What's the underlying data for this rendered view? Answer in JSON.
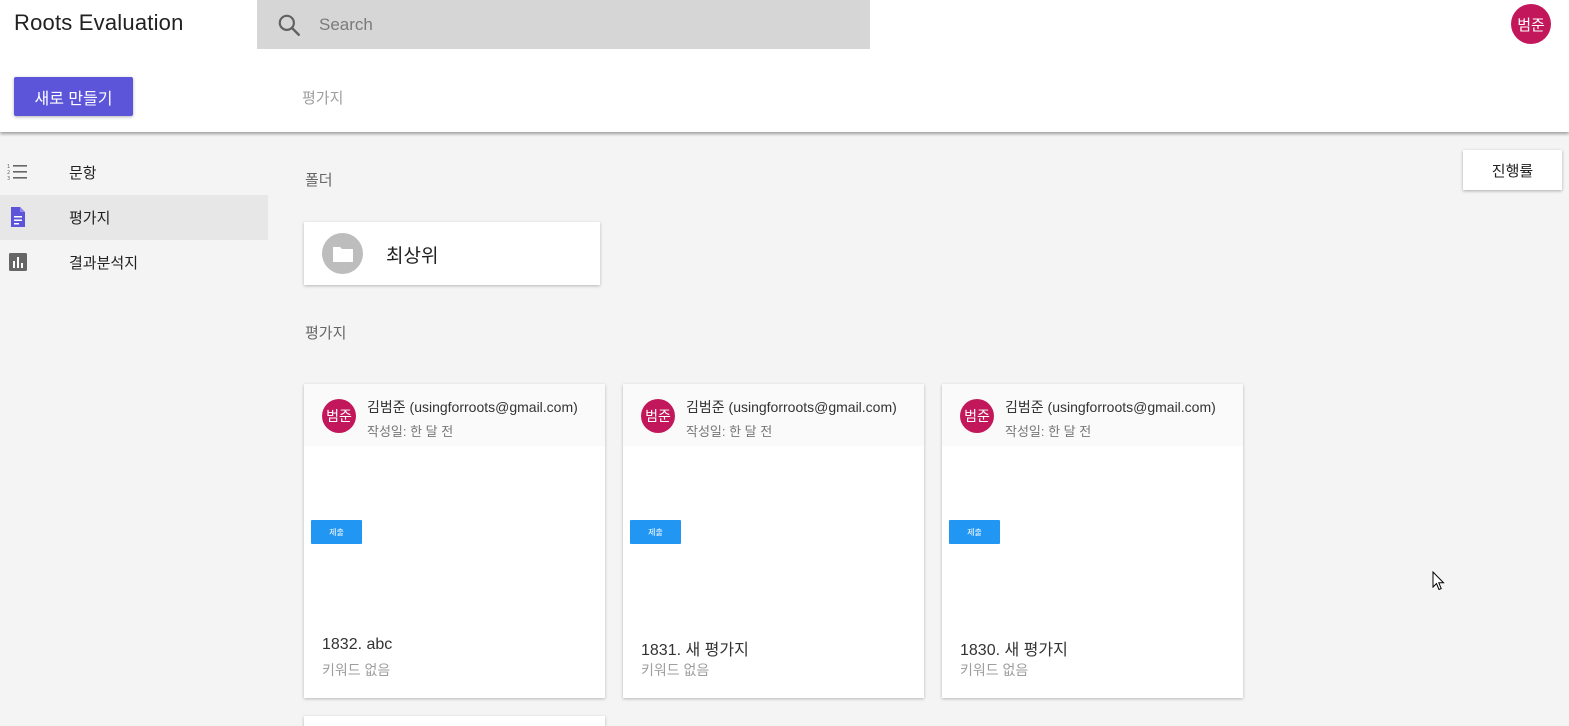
{
  "header": {
    "app_title": "Roots Evaluation",
    "search_placeholder": "Search",
    "user_avatar": "범준",
    "new_button": "새로 만들기",
    "breadcrumb": "평가지"
  },
  "sidebar": {
    "items": [
      {
        "label": "문항",
        "icon": "numbered-list-icon",
        "active": false
      },
      {
        "label": "평가지",
        "icon": "document-icon",
        "active": true
      },
      {
        "label": "결과분석지",
        "icon": "bar-chart-icon",
        "active": false
      }
    ]
  },
  "main": {
    "folder_section_label": "폴더",
    "progress_button": "진행률",
    "folder": {
      "label": "최상위",
      "icon": "folder-icon"
    },
    "sheets_section_label": "평가지",
    "cards": [
      {
        "avatar": "범준",
        "author": "김범준 (usingforroots@gmail.com)",
        "date": "작성일: 한 달 전",
        "tag": "제출",
        "title": "1832. abc",
        "keywords": "키워드 없음"
      },
      {
        "avatar": "범준",
        "author": "김범준 (usingforroots@gmail.com)",
        "date": "작성일: 한 달 전",
        "tag": "제출",
        "title": "1831. 새 평가지",
        "keywords": "키워드 없음"
      },
      {
        "avatar": "범준",
        "author": "김범준 (usingforroots@gmail.com)",
        "date": "작성일: 한 달 전",
        "tag": "제출",
        "title": "1830. 새 평가지",
        "keywords": "키워드 없음"
      }
    ]
  },
  "colors": {
    "primary_button": "#5c55d9",
    "avatar": "#c2185b",
    "submit_tag": "#2196f3",
    "sidebar_active_icon": "#5c55d9",
    "search_bg": "#d6d6d6"
  }
}
